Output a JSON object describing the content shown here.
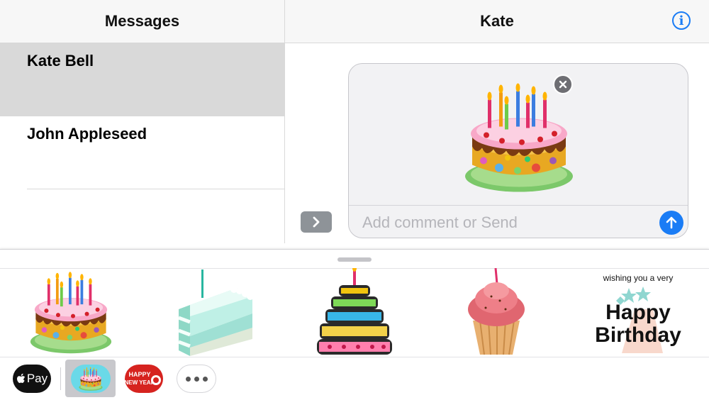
{
  "conversation_list": {
    "title": "Messages",
    "items": [
      {
        "name": "Kate Bell",
        "selected": true
      },
      {
        "name": "John Appleseed",
        "selected": false
      }
    ]
  },
  "conversation": {
    "title": "Kate",
    "info_icon": "info-circle-icon",
    "expand_icon": "chevron-right-icon"
  },
  "compose": {
    "placeholder": "Add comment or Send",
    "value": "",
    "attachment": "birthday-cake-sticker",
    "remove_icon": "close-icon",
    "send_icon": "arrow-up-icon"
  },
  "sticker_drawer": {
    "stickers": [
      {
        "name": "birthday-cake-with-candles"
      },
      {
        "name": "mint-cake-slice"
      },
      {
        "name": "tiered-birthday-cake"
      },
      {
        "name": "pink-cupcake"
      },
      {
        "name": "happy-birthday-cupcake",
        "text_line1": "wishing you a very",
        "text_line2": "Happy",
        "text_line3": "Birthday"
      }
    ]
  },
  "app_tray": {
    "apple_pay": {
      "logo": "apple-logo-icon",
      "label": "Pay"
    },
    "apps": [
      {
        "name": "birthday-cake-app",
        "selected": true
      },
      {
        "name": "happy-new-year-app",
        "text_line1": "HAPPY",
        "text_line2": "NEW YEAR"
      }
    ],
    "more_icon": "ellipsis-icon"
  },
  "colors": {
    "accent": "#1a7cf5",
    "selected_row": "#d9d9d9",
    "header_bg": "#f7f7f7"
  }
}
